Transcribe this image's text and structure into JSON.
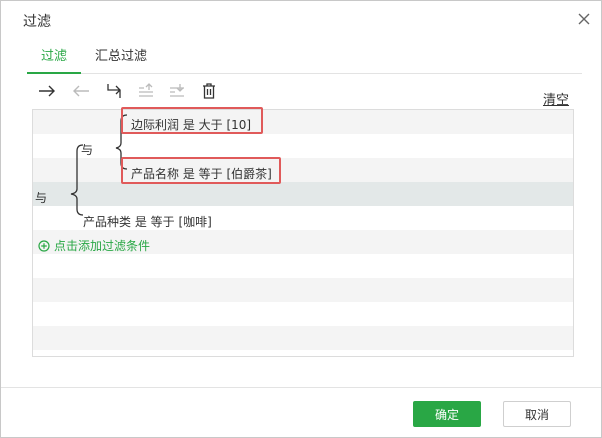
{
  "dialog": {
    "title": "过滤"
  },
  "tabs": [
    {
      "label": "过滤",
      "active": true
    },
    {
      "label": "汇总过滤",
      "active": false
    }
  ],
  "toolbar": {
    "icons": [
      "arrow-right-icon",
      "arrow-left-icon",
      "swap-icon",
      "move-up-icon",
      "move-down-icon",
      "trash-icon"
    ],
    "clear_label": "清空"
  },
  "filters": {
    "outer_op": "与",
    "inner_op": "与",
    "conditions": [
      {
        "text": "边际利润 是 大于 [10]",
        "highlighted": true
      },
      {
        "text": "产品名称 是 等于 [伯爵茶]",
        "highlighted": true
      },
      {
        "text": "产品种类 是 等于 [咖啡]",
        "highlighted": false
      }
    ],
    "add_label": "点击添加过滤条件"
  },
  "footer": {
    "ok_label": "确定",
    "cancel_label": "取消"
  },
  "colors": {
    "accent": "#29a745",
    "highlight": "#e05a5a"
  }
}
